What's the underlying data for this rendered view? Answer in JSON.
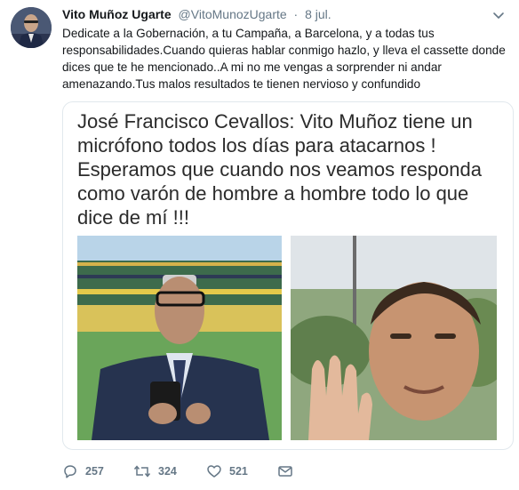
{
  "author": {
    "name": "Vito Muñoz Ugarte",
    "handle": "@VitoMunozUgarte",
    "separator": "·",
    "date": "8 jul."
  },
  "tweet": {
    "text": "Dedicate a la Gobernación, a tu Campaña, a Barcelona, y a todas tus responsabilidades.Cuando quieras hablar conmigo hazlo, y lleva el cassette donde dices que te he mencionado..A mi no me vengas a sorprender ni andar amenazando.Tus malos resultados te tienen nervioso y confundido"
  },
  "media": {
    "quote": "José Francisco Cevallos: Vito Muñoz tiene un micrófono todos los días para atacarnos ! Esperamos que cuando nos veamos responda como varón de hombre a hombre todo lo que dice de mí !!!"
  },
  "actions": {
    "replies": "257",
    "retweets": "324",
    "likes": "521"
  },
  "icons": [
    "caret-down-icon",
    "reply-icon",
    "retweet-icon",
    "like-icon",
    "message-icon"
  ],
  "colors": {
    "secondary_text": "#657786",
    "border": "#e1e8ed"
  }
}
